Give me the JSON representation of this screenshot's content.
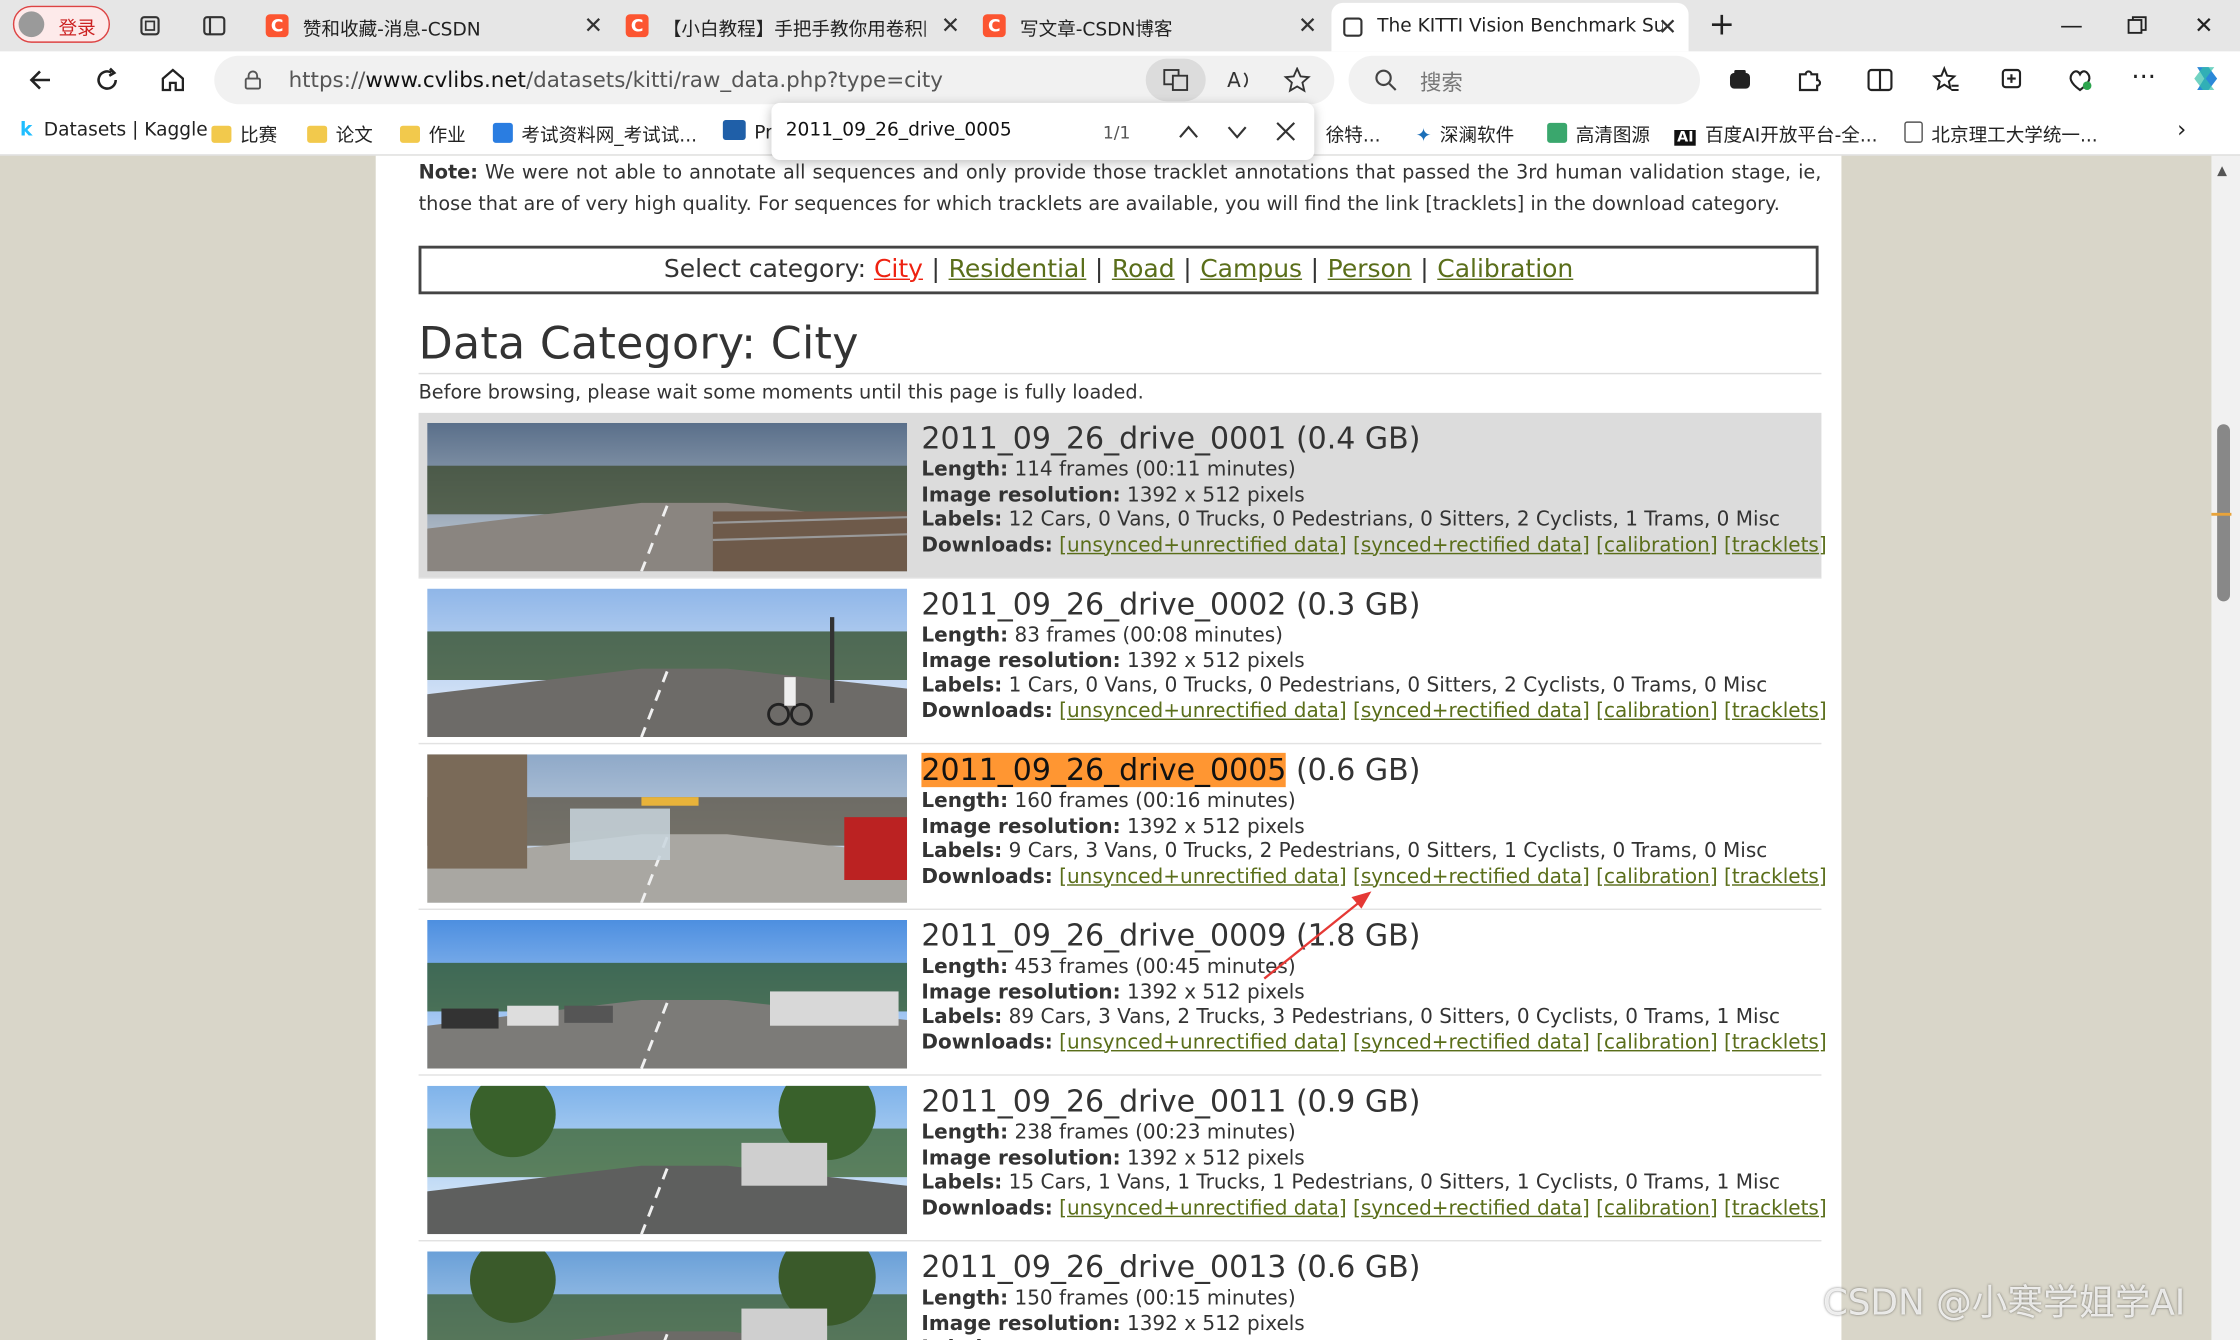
{
  "browser": {
    "login_label": "登录",
    "tabs": [
      {
        "title": "赞和收藏-消息-CSDN",
        "favicon": "C"
      },
      {
        "title": "【小白教程】手把手教你用卷积网",
        "favicon": "C"
      },
      {
        "title": "写文章-CSDN博客",
        "favicon": "C"
      },
      {
        "title": "The KITTI Vision Benchmark Suite",
        "favicon": ""
      }
    ],
    "url_prefix": "https://",
    "url_host": "www.cvlibs.net",
    "url_path": "/datasets/kitti/raw_data.php?type=city",
    "search_placeholder": "搜索",
    "bookmarks": [
      {
        "label": "Datasets | Kaggle",
        "icon": "kaggle-icon",
        "color": "#20beff"
      },
      {
        "label": "比赛",
        "icon": "folder-icon",
        "color": "#f2c94c"
      },
      {
        "label": "论文",
        "icon": "folder-icon",
        "color": "#f2c94c"
      },
      {
        "label": "作业",
        "icon": "folder-icon",
        "color": "#f2c94c"
      },
      {
        "label": "考试资料网_考试试...",
        "icon": "site-icon",
        "color": "#2a7de1"
      },
      {
        "label": "Pr",
        "icon": "onenote-icon",
        "color": "#1f5fa8"
      },
      {
        "label": "徐特...",
        "icon": "site-icon",
        "color": "#888888"
      },
      {
        "label": "深澜软件",
        "icon": "star-site-icon",
        "color": "#1c6fb8"
      },
      {
        "label": "高清图源",
        "icon": "site-icon",
        "color": "#3aa76d"
      },
      {
        "label": "百度AI开放平台-全...",
        "icon": "ai-icon",
        "color": "#111111"
      },
      {
        "label": "北京理工大学统一...",
        "icon": "doc-icon",
        "color": "#555555"
      }
    ],
    "find": {
      "query": "2011_09_26_drive_0005",
      "count": "1/1"
    }
  },
  "page": {
    "note_label": "Note:",
    "note_text": "We were not able to annotate all sequences and only provide those tracklet annotations that passed the 3rd human validation stage, ie, those that are of very high quality. For sequences for which tracklets are available, you will find the link [tracklets] in the download category.",
    "select_label": "Select category:",
    "categories": [
      "City",
      "Residential",
      "Road",
      "Campus",
      "Person",
      "Calibration"
    ],
    "title": "Data Category: City",
    "wait_text": "Before browsing, please wait some moments until this page is fully loaded.",
    "length_key": "Length:",
    "res_key": "Image resolution:",
    "labels_key": "Labels:",
    "downloads_key": "Downloads:",
    "links": [
      "[unsynced+unrectified data]",
      "[synced+rectified data]",
      "[calibration]",
      "[tracklets]"
    ],
    "drives": [
      {
        "name": "2011_09_26_drive_0001",
        "size": "(0.4 GB)",
        "length": "114 frames (00:11 minutes)",
        "resolution": "1392 x 512 pixels",
        "labels": "12 Cars, 0 Vans, 0 Trucks, 0 Pedestrians, 0 Sitters, 2 Cyclists, 1 Trams, 0 Misc"
      },
      {
        "name": "2011_09_26_drive_0002",
        "size": "(0.3 GB)",
        "length": "83 frames (00:08 minutes)",
        "resolution": "1392 x 512 pixels",
        "labels": "1 Cars, 0 Vans, 0 Trucks, 0 Pedestrians, 0 Sitters, 2 Cyclists, 0 Trams, 0 Misc"
      },
      {
        "name": "2011_09_26_drive_0005",
        "size": "(0.6 GB)",
        "length": "160 frames (00:16 minutes)",
        "resolution": "1392 x 512 pixels",
        "labels": "9 Cars, 3 Vans, 0 Trucks, 2 Pedestrians, 0 Sitters, 1 Cyclists, 0 Trams, 0 Misc"
      },
      {
        "name": "2011_09_26_drive_0009",
        "size": "(1.8 GB)",
        "length": "453 frames (00:45 minutes)",
        "resolution": "1392 x 512 pixels",
        "labels": "89 Cars, 3 Vans, 2 Trucks, 3 Pedestrians, 0 Sitters, 0 Cyclists, 0 Trams, 1 Misc"
      },
      {
        "name": "2011_09_26_drive_0011",
        "size": "(0.9 GB)",
        "length": "238 frames (00:23 minutes)",
        "resolution": "1392 x 512 pixels",
        "labels": "15 Cars, 1 Vans, 1 Trucks, 1 Pedestrians, 0 Sitters, 1 Cyclists, 0 Trams, 1 Misc"
      },
      {
        "name": "2011_09_26_drive_0013",
        "size": "(0.6 GB)",
        "length": "150 frames (00:15 minutes)",
        "resolution": "1392 x 512 pixels",
        "labels": ""
      }
    ]
  },
  "watermark": "CSDN @小寒学姐学AI",
  "colors": {
    "link": "#5a6e1a",
    "selected_category": "#ee2211",
    "find_highlight": "#ff9632",
    "page_bg": "#d9d6c9",
    "annotation_arrow": "#e53935"
  }
}
